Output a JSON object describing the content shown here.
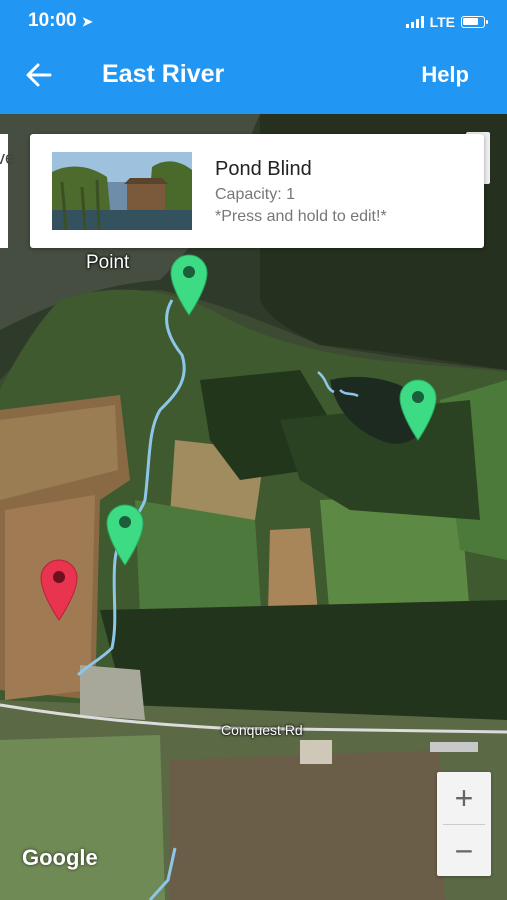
{
  "status_bar": {
    "time": "10:00",
    "network": "LTE"
  },
  "header": {
    "title": "East River",
    "help_label": "Help"
  },
  "info_card": {
    "title": "Pond Blind",
    "capacity": "Capacity: 1",
    "hint": "*Press and hold to edit!*"
  },
  "map": {
    "left_card_fragment": "rve",
    "point_label": "Point",
    "road_label": "Conquest Rd",
    "attribution": "Google",
    "zoom_in": "+",
    "zoom_out": "−"
  },
  "markers": [
    {
      "name": "marker-green-1",
      "color": "#3ddc84"
    },
    {
      "name": "marker-green-2",
      "color": "#3ddc84"
    },
    {
      "name": "marker-green-3",
      "color": "#3ddc84"
    },
    {
      "name": "marker-red",
      "color": "#e8344e"
    }
  ],
  "colors": {
    "header": "#2196f3",
    "trail": "#8ec6ea"
  }
}
